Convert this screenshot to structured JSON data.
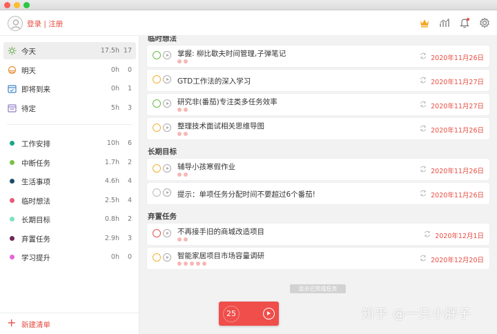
{
  "header": {
    "login_label": "登录 | 注册"
  },
  "sidebar": {
    "smart": [
      {
        "label": "今天",
        "hours": "17.5h",
        "count": "17",
        "icon": "sun-icon",
        "color": "#6aa84f",
        "active": true
      },
      {
        "label": "明天",
        "hours": "0h",
        "count": "0",
        "icon": "sunset-icon",
        "color": "#e69138"
      },
      {
        "label": "即将到来",
        "hours": "0h",
        "count": "1",
        "icon": "calendar-icon",
        "color": "#3d85c6"
      },
      {
        "label": "待定",
        "hours": "5h",
        "count": "3",
        "icon": "calendar-pending-icon",
        "color": "#8e7cc3"
      }
    ],
    "lists": [
      {
        "label": "工作安排",
        "hours": "10h",
        "count": "6",
        "color": "#1aa68a"
      },
      {
        "label": "中断任务",
        "hours": "1.7h",
        "count": "2",
        "color": "#7bc043"
      },
      {
        "label": "生活事项",
        "hours": "4.6h",
        "count": "4",
        "color": "#1c4e6b"
      },
      {
        "label": "临时想法",
        "hours": "2.5h",
        "count": "4",
        "color": "#e8597a"
      },
      {
        "label": "长期目标",
        "hours": "0.8h",
        "count": "2",
        "color": "#7fe0c0"
      },
      {
        "label": "弃置任务",
        "hours": "2.9h",
        "count": "3",
        "color": "#6b2a5a"
      },
      {
        "label": "学习提升",
        "hours": "0h",
        "count": "0",
        "color": "#e765d8"
      }
    ],
    "new_list_label": "新建清单"
  },
  "main": {
    "sections": [
      {
        "title": "临时想法",
        "tasks": [
          {
            "title": "掌握: 柳比歇夫时间管理,子弹笔记",
            "date": "2020年11月26日",
            "ring": "#66bb44",
            "tomatoes": 2
          },
          {
            "title": "GTD工作法的深入学习",
            "date": "2020年11月27日",
            "ring": "#f0b030",
            "tomatoes": 0
          },
          {
            "title": "研究非(番茄)专注类多任务效率",
            "date": "2020年11月27日",
            "ring": "#66bb44",
            "tomatoes": 2
          },
          {
            "title": "整理技术面试相关思维导图",
            "date": "2020年11月26日",
            "ring": "#f0b030",
            "tomatoes": 2
          }
        ]
      },
      {
        "title": "长期目标",
        "tasks": [
          {
            "title": "辅导小孩寒假作业",
            "date": "2020年11月26日",
            "ring": "#f0b030",
            "tomatoes": 2
          },
          {
            "title": "提示：单项任务分配时间不要超过6个番茄!",
            "date": "2020年11月26日",
            "ring": "#bbbbbb",
            "tomatoes": 0
          }
        ]
      },
      {
        "title": "弃置任务",
        "tasks": [
          {
            "title": "不再接手旧的商城改造项目",
            "date": "2020年12月1日",
            "ring": "#e5534b",
            "tomatoes": 2
          },
          {
            "title": "智能家居项目市场容量调研",
            "date": "2020年12月20日",
            "ring": "#f0b030",
            "tomatoes": 5
          }
        ]
      }
    ],
    "show_done_label": "显示已完成任务",
    "timer_value": "25",
    "watermark": "知乎 @一只小胖子"
  }
}
